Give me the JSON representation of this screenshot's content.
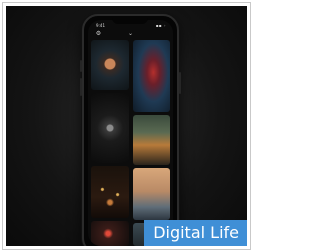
{
  "thumbnail": {
    "caption": "Digital Life",
    "caption_background": "#3f8fd6",
    "frame_border": "#c9c9c9",
    "stage_background": "#141414"
  },
  "phone": {
    "status_bar": {
      "time": "9:41",
      "icons": "▪▪ ◦"
    },
    "top_icons": [
      "gear-icon",
      "chevron-down-icon"
    ],
    "grid_images": [
      "lantern-photo",
      "red-smoke-photo",
      "watch-photo",
      "forest-road-photo",
      "night-lights-photo",
      "landscape-photo",
      "red-light-photo",
      "dark-photo"
    ]
  }
}
